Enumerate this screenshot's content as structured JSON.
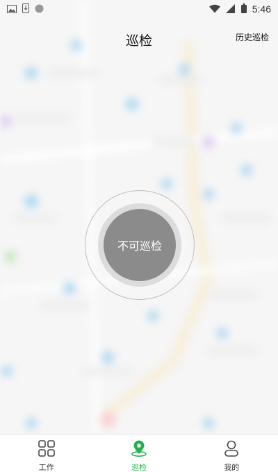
{
  "status_bar": {
    "time": "5:46",
    "left_icons": [
      "image-icon",
      "download-status-icon",
      "circle-dot-icon"
    ],
    "right_icons": [
      "wifi-icon",
      "signal-icon",
      "battery-icon"
    ]
  },
  "header": {
    "title": "巡检",
    "history_label": "历史巡检"
  },
  "patrol_button": {
    "label": "不可巡检",
    "color": "#8b8b8b"
  },
  "tabs": [
    {
      "label": "工作",
      "icon": "grid-icon",
      "active": false
    },
    {
      "label": "巡检",
      "icon": "location-pin-icon",
      "active": true
    },
    {
      "label": "我的",
      "icon": "person-icon",
      "active": false
    }
  ],
  "colors": {
    "accent": "#22b24c",
    "background": "#f4f4f4"
  }
}
